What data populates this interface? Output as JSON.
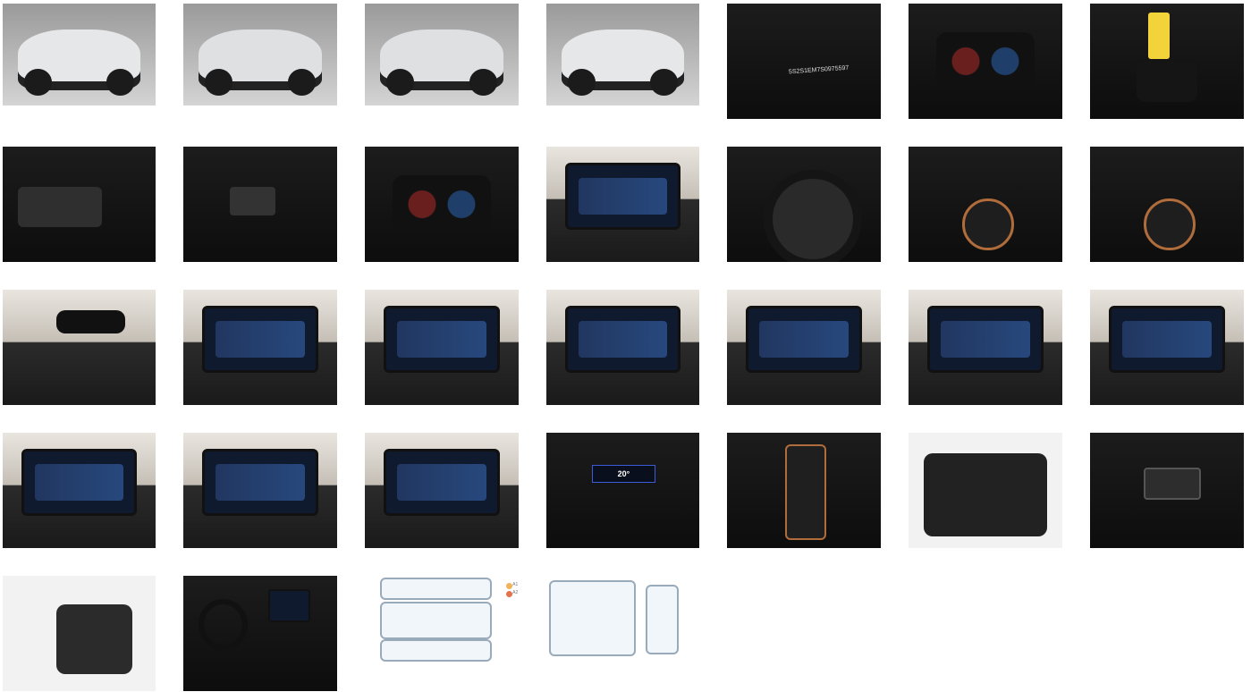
{
  "gallery": {
    "thumbnails": [
      {
        "id": "car-front-left",
        "kind": "studio"
      },
      {
        "id": "car-rear-left",
        "kind": "studio"
      },
      {
        "id": "car-rear",
        "kind": "studio"
      },
      {
        "id": "car-front-right",
        "kind": "studio"
      },
      {
        "id": "windshield-vin",
        "kind": "dark"
      },
      {
        "id": "instrument-cluster-1",
        "kind": "dark"
      },
      {
        "id": "keys",
        "kind": "dark"
      },
      {
        "id": "window-switches",
        "kind": "dark"
      },
      {
        "id": "light-switch-panel",
        "kind": "dark"
      },
      {
        "id": "instrument-cluster-2",
        "kind": "dark"
      },
      {
        "id": "infotainment-rear-camera",
        "kind": "garage"
      },
      {
        "id": "steering-wheel-overview",
        "kind": "dark"
      },
      {
        "id": "steering-wheel-controls-left",
        "kind": "dark"
      },
      {
        "id": "steering-wheel-controls-right",
        "kind": "dark"
      },
      {
        "id": "mirror-and-sunroof",
        "kind": "garage"
      },
      {
        "id": "infotainment-menu-1",
        "kind": "garage"
      },
      {
        "id": "infotainment-menu-2",
        "kind": "garage"
      },
      {
        "id": "infotainment-menu-3",
        "kind": "garage"
      },
      {
        "id": "infotainment-menu-4",
        "kind": "garage"
      },
      {
        "id": "infotainment-menu-5",
        "kind": "garage"
      },
      {
        "id": "infotainment-menu-6",
        "kind": "garage"
      },
      {
        "id": "infotainment-menu-7",
        "kind": "garage"
      },
      {
        "id": "infotainment-ambient-light",
        "kind": "garage"
      },
      {
        "id": "infotainment-climate",
        "kind": "garage"
      },
      {
        "id": "rear-climate-panel",
        "kind": "dark"
      },
      {
        "id": "gear-selector",
        "kind": "dark"
      },
      {
        "id": "open-trunk",
        "kind": "light"
      },
      {
        "id": "tailgate-button",
        "kind": "dark"
      },
      {
        "id": "rear-seats",
        "kind": "light"
      },
      {
        "id": "interior-dashboard",
        "kind": "dark"
      },
      {
        "id": "damage-diagram-exterior",
        "kind": "white"
      },
      {
        "id": "damage-diagram-interior",
        "kind": "white"
      }
    ]
  },
  "overlay_text": {
    "vin_partial": "5S2S1EM7S0975597",
    "climate_temp": "20°"
  },
  "legend": {
    "a1": "A1",
    "a2": "A2"
  },
  "colors": {
    "accent_copper": "#b06c3a",
    "legend_a1": "#f0b35a",
    "legend_a2": "#e2734a"
  }
}
